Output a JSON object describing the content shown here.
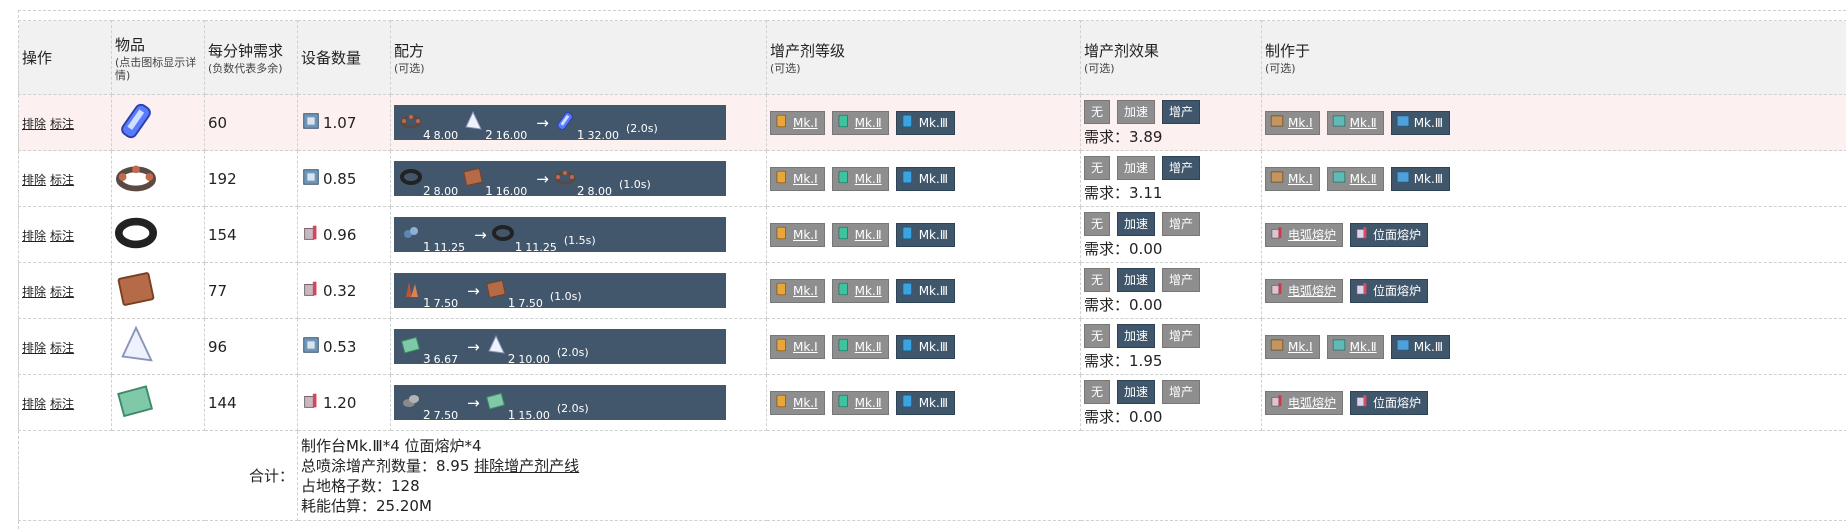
{
  "headers": {
    "op": "操作",
    "item": "物品",
    "item_sub": "(点击图标显示详情)",
    "rate": "每分钟需求",
    "rate_sub": "(负数代表多余)",
    "devices": "设备数量",
    "recipe": "配方",
    "recipe_sub": "(可选)",
    "prolif_level": "增产剂等级",
    "prolif_level_sub": "(可选)",
    "prolif_effect": "增产剂效果",
    "prolif_effect_sub": "(可选)",
    "made_in": "制作于",
    "made_in_sub": "(可选)"
  },
  "ops": {
    "exclude": "排除",
    "mark": "标注"
  },
  "prolif_levels": [
    "Mk.Ⅰ",
    "Mk.Ⅱ",
    "Mk.Ⅲ"
  ],
  "effects": {
    "none": "无",
    "speed": "加速",
    "extra": "增产"
  },
  "demand_prefix": "需求：",
  "rows": [
    {
      "item_icon": "particle-container-icon",
      "rate": "60",
      "device_icon": "assembler-icon",
      "devices": "1.07",
      "recipe": {
        "inputs": [
          {
            "icon": "electromagnetic-turbine-icon",
            "count": "4",
            "rate": "8.00"
          },
          {
            "icon": "prism-icon",
            "count": "2",
            "rate": "16.00"
          }
        ],
        "outputs": [
          {
            "icon": "particle-container-icon",
            "count": "1",
            "rate": "32.00"
          }
        ],
        "time": "(2.0s)"
      },
      "effect_selected": "extra",
      "demand": "3.89",
      "made_in": [
        "Mk.Ⅰ",
        "Mk.Ⅱ",
        "Mk.Ⅲ"
      ],
      "made_in_type": "assembler"
    },
    {
      "item_icon": "electromagnetic-turbine-icon",
      "rate": "192",
      "device_icon": "assembler-icon",
      "devices": "0.85",
      "recipe": {
        "inputs": [
          {
            "icon": "magnetic-coil-icon",
            "count": "2",
            "rate": "8.00"
          },
          {
            "icon": "copper-ingot-icon",
            "count": "1",
            "rate": "16.00"
          }
        ],
        "outputs": [
          {
            "icon": "electromagnetic-turbine-icon",
            "count": "2",
            "rate": "8.00"
          }
        ],
        "time": "(1.0s)"
      },
      "effect_selected": "extra",
      "demand": "3.11",
      "made_in": [
        "Mk.Ⅰ",
        "Mk.Ⅱ",
        "Mk.Ⅲ"
      ],
      "made_in_type": "assembler"
    },
    {
      "item_icon": "magnetic-coil-icon",
      "rate": "154",
      "device_icon": "smelter-icon",
      "devices": "0.96",
      "recipe": {
        "inputs": [
          {
            "icon": "iron-ore-icon",
            "count": "1",
            "rate": "11.25"
          }
        ],
        "outputs": [
          {
            "icon": "magnetic-coil-icon",
            "count": "1",
            "rate": "11.25"
          }
        ],
        "time": "(1.5s)"
      },
      "effect_selected": "speed",
      "demand": "0.00",
      "made_in": [
        "电弧熔炉",
        "位面熔炉"
      ],
      "made_in_type": "smelter"
    },
    {
      "item_icon": "copper-ingot-icon",
      "rate": "77",
      "device_icon": "smelter-icon",
      "devices": "0.32",
      "recipe": {
        "inputs": [
          {
            "icon": "copper-ore-icon",
            "count": "1",
            "rate": "7.50"
          }
        ],
        "outputs": [
          {
            "icon": "copper-ingot-icon",
            "count": "1",
            "rate": "7.50"
          }
        ],
        "time": "(1.0s)"
      },
      "effect_selected": "speed",
      "demand": "0.00",
      "made_in": [
        "电弧熔炉",
        "位面熔炉"
      ],
      "made_in_type": "smelter"
    },
    {
      "item_icon": "prism-icon",
      "rate": "96",
      "device_icon": "assembler-icon",
      "devices": "0.53",
      "recipe": {
        "inputs": [
          {
            "icon": "glass-icon",
            "count": "3",
            "rate": "6.67"
          }
        ],
        "outputs": [
          {
            "icon": "prism-icon",
            "count": "2",
            "rate": "10.00"
          }
        ],
        "time": "(2.0s)"
      },
      "effect_selected": "speed",
      "demand": "1.95",
      "made_in": [
        "Mk.Ⅰ",
        "Mk.Ⅱ",
        "Mk.Ⅲ"
      ],
      "made_in_type": "assembler"
    },
    {
      "item_icon": "glass-icon",
      "rate": "144",
      "device_icon": "smelter-icon",
      "devices": "1.20",
      "recipe": {
        "inputs": [
          {
            "icon": "stone-icon",
            "count": "2",
            "rate": "7.50"
          }
        ],
        "outputs": [
          {
            "icon": "glass-icon",
            "count": "1",
            "rate": "15.00"
          }
        ],
        "time": "(2.0s)"
      },
      "effect_selected": "speed",
      "demand": "0.00",
      "made_in": [
        "电弧熔炉",
        "位面熔炉"
      ],
      "made_in_type": "smelter"
    }
  ],
  "total": {
    "label": "合计：",
    "line1": "制作台Mk.Ⅲ*4 位面熔炉*4",
    "line2_prefix": "总喷涂增产剂数量：8.95 ",
    "line2_link": "排除增产剂产线",
    "line3": "占地格子数：128",
    "line4": "耗能估算：25.20M"
  },
  "colors": {
    "selected": "#3f566b",
    "unselected": "#8e8e8e",
    "highlight_row": "#fdf0f0",
    "recipe_bg": "#42576b"
  }
}
